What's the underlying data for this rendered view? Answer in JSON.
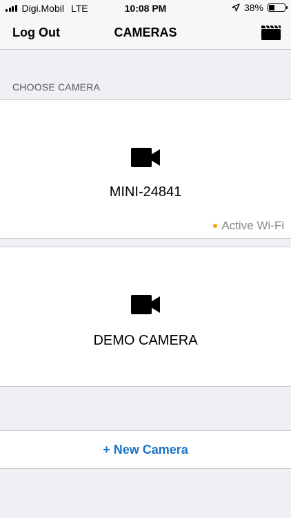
{
  "status_bar": {
    "carrier": "Digi.Mobil",
    "network": "LTE",
    "time": "10:08 PM",
    "battery_percent": "38%",
    "battery_level": 0.38,
    "icons": [
      "signal-bars-icon",
      "location-arrow-icon",
      "battery-icon"
    ]
  },
  "nav": {
    "left_label": "Log Out",
    "title": "CAMERAS",
    "right_icon": "clapperboard-icon"
  },
  "section": {
    "header": "CHOOSE CAMERA"
  },
  "cameras": [
    {
      "name": "MINI-24841",
      "status": "Active Wi-Fi",
      "status_color": "#f5a623",
      "icon": "video-camera-icon"
    },
    {
      "name": "DEMO CAMERA",
      "status": "",
      "icon": "video-camera-icon"
    }
  ],
  "actions": {
    "new_camera_label": "+ New Camera"
  },
  "colors": {
    "accent": "#1a73c8",
    "background": "#efeff4",
    "status_dot": "#f5a623"
  }
}
